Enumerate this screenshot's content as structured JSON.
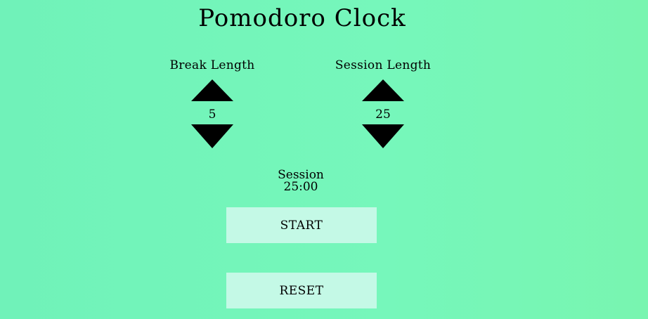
{
  "app": {
    "title": "Pomodoro Clock"
  },
  "break": {
    "label": "Break Length",
    "value": "5"
  },
  "session": {
    "label": "Session Length",
    "value": "25"
  },
  "timer": {
    "label": "Session",
    "time": "25:00"
  },
  "buttons": {
    "start": "START",
    "reset": "RESET"
  },
  "icons": {
    "increment": "triangle-up-icon",
    "decrement": "triangle-down-icon"
  },
  "colors": {
    "background": "#74f5ba",
    "button": "#c4f9e6",
    "text": "#000000"
  }
}
